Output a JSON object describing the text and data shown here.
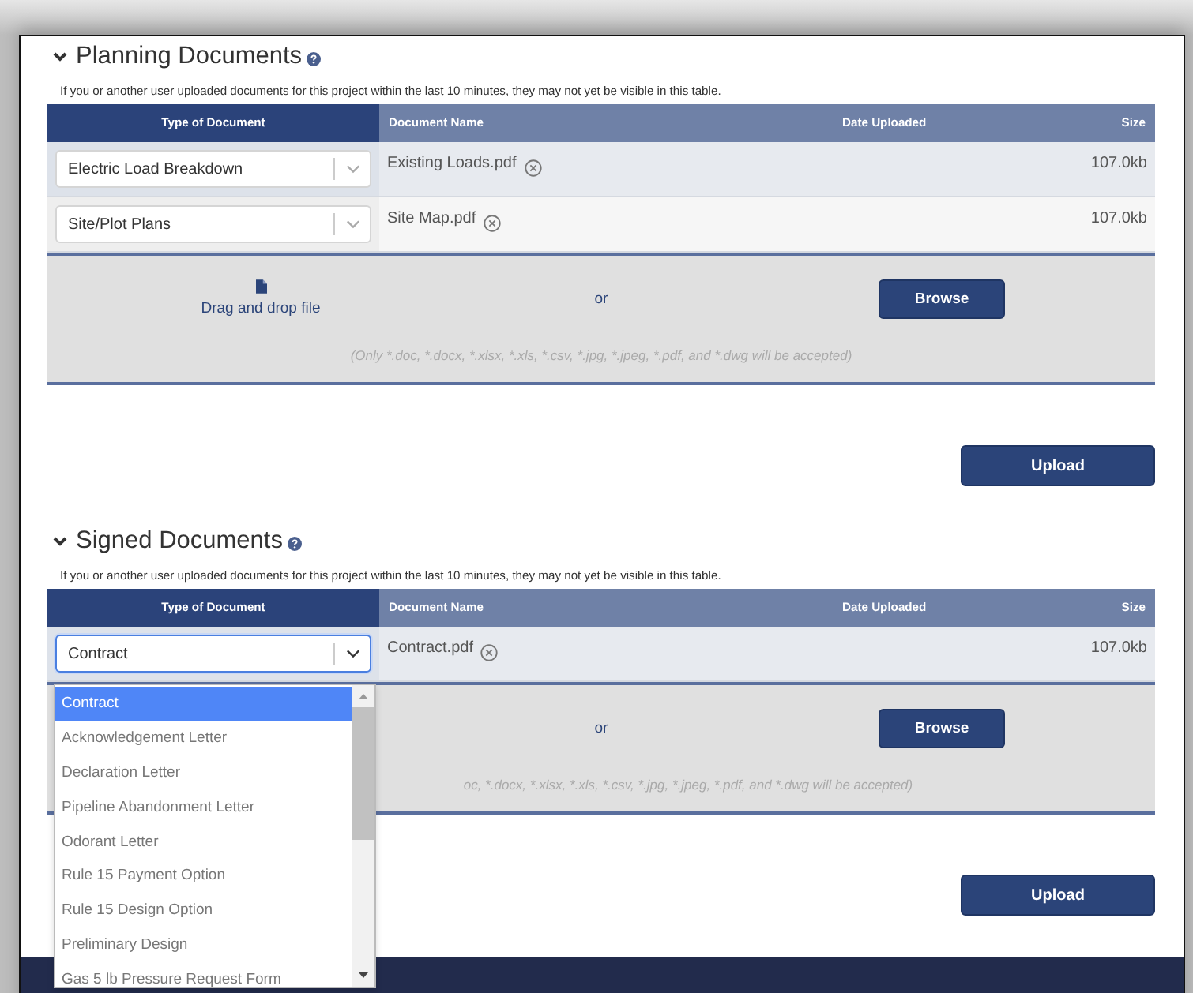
{
  "sections": [
    {
      "title": "Planning Documents",
      "expanded": true,
      "notice": "If you or another user uploaded documents for this project within the last 10 minutes, they may not yet be visible in this table.",
      "columns": [
        "Type of Document",
        "Document Name",
        "Date Uploaded",
        "Size"
      ],
      "rows": [
        {
          "type": "Electric Load Breakdown",
          "focused": false,
          "document": "Existing Loads.pdf",
          "size": "107.0kb"
        },
        {
          "type": "Site/Plot Plans",
          "focused": false,
          "document": "Site Map.pdf",
          "size": "107.0kb"
        }
      ],
      "dropzone": {
        "label": "Drag and drop file",
        "or": "or",
        "browse": "Browse",
        "accepted": "(Only *.doc, *.docx, *.xlsx, *.xls, *.csv, *.jpg, *.jpeg, *.pdf, and *.dwg will be accepted)"
      },
      "upload": "Upload"
    },
    {
      "title": "Signed Documents",
      "expanded": true,
      "notice": "If you or another user uploaded documents for this project within the last 10 minutes, they may not yet be visible in this table.",
      "columns": [
        "Type of Document",
        "Document Name",
        "Date Uploaded",
        "Size"
      ],
      "rows": [
        {
          "type": "Contract",
          "focused": true,
          "document": "Contract.pdf",
          "size": "107.0kb",
          "options": [
            {
              "label": "Contract",
              "selected": true
            },
            {
              "label": "Acknowledgement Letter",
              "selected": false
            },
            {
              "label": "Declaration Letter",
              "selected": false
            },
            {
              "label": "Pipeline Abandonment Letter",
              "selected": false
            },
            {
              "label": "Odorant Letter",
              "selected": false
            },
            {
              "label": "Rule 15 Payment Option",
              "selected": false
            },
            {
              "label": "Rule 15 Design Option",
              "selected": false
            },
            {
              "label": "Preliminary Design",
              "selected": false
            },
            {
              "label": "Gas 5 lb Pressure Request Form",
              "selected": false
            }
          ]
        }
      ],
      "dropzone": {
        "or": "or",
        "browse": "Browse",
        "accepted": "oc, *.docx, *.xlsx, *.xls, *.csv, *.jpg, *.jpeg, *.pdf, and *.dwg will be accepted)"
      },
      "upload": "Upload"
    }
  ]
}
